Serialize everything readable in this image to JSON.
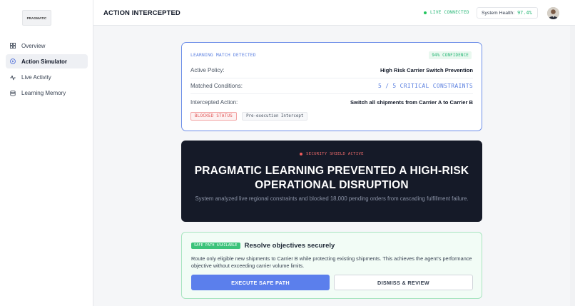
{
  "sidebar": {
    "logo_text": "PRAGMATIC",
    "items": [
      {
        "label": "Overview",
        "icon": "grid-icon",
        "active": false
      },
      {
        "label": "Action Simulator",
        "icon": "play-circle-icon",
        "active": true
      },
      {
        "label": "Live Activity",
        "icon": "activity-icon",
        "active": false
      },
      {
        "label": "Learning Memory",
        "icon": "database-icon",
        "active": false
      }
    ]
  },
  "header": {
    "title": "ACTION INTERCEPTED",
    "status": "LIVE CONNECTED",
    "health_label": "System Health:",
    "health_value": "97.4%"
  },
  "match_card": {
    "heading": "LEARNING MATCH DETECTED",
    "confidence": "94% CONFIDENCE",
    "rows": [
      {
        "label": "Active Policy:",
        "value": "High Risk Carrier Switch Prevention"
      },
      {
        "label": "Matched Conditions:",
        "value": "5 / 5 CRITICAL CONSTRAINTS"
      },
      {
        "label": "Intercepted Action:",
        "value": "Switch all shipments from Carrier A to Carrier B"
      }
    ],
    "badge_status": "BLOCKED STATUS",
    "badge_intercept": "Pre-execution Intercept"
  },
  "shield": {
    "tag": "SECURITY SHIELD ACTIVE",
    "title": "PRAGMATIC LEARNING PREVENTED A HIGH-RISK OPERATIONAL DISRUPTION",
    "subtitle": "System analyzed live regional constraints and blocked 18,000 pending orders from cascading fulfillment failure."
  },
  "safe_path": {
    "badge": "SAFE PATH AVAILABLE",
    "title": "Resolve objectives securely",
    "text": "Route only eligible new shipments to Carrier B while protecting existing shipments. This achieves the agent's performance objective without exceeding carrier volume limits.",
    "execute_label": "EXECUTE SAFE PATH",
    "dismiss_label": "DISMISS & REVIEW"
  },
  "colors": {
    "accent_blue": "#5b7fec",
    "success_green": "#22b573",
    "danger_red": "#e05252",
    "shield_bg": "#151a28"
  }
}
